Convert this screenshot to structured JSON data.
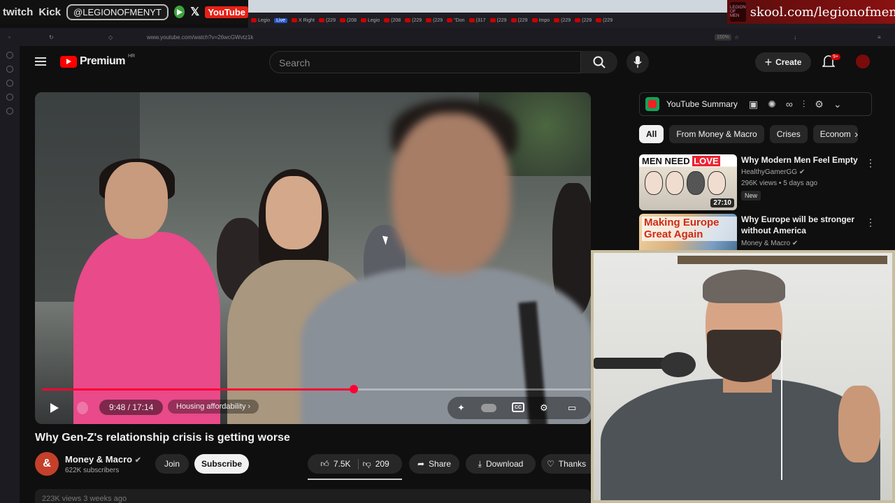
{
  "stream_overlay": {
    "brand1": "twitch",
    "brand2": "Kick",
    "handle": "@LEGIONOFMENYT",
    "youtube_label": "YouTube",
    "skool_url": "skool.com/legionofmen",
    "skool_logo_text": "LEGION OF MEN"
  },
  "browser": {
    "tabs": [
      {
        "label": "Legio",
        "live": false
      },
      {
        "label": "Live",
        "live": true
      },
      {
        "label": "X Right",
        "live": false
      },
      {
        "label": "(229",
        "live": false
      },
      {
        "label": "(208",
        "live": false
      },
      {
        "label": "Legio",
        "live": false
      },
      {
        "label": "(208",
        "live": false
      },
      {
        "label": "(229",
        "live": false
      },
      {
        "label": "(229",
        "live": false
      },
      {
        "label": "\"Don",
        "live": false
      },
      {
        "label": "(317",
        "live": false
      },
      {
        "label": "(229",
        "live": false
      },
      {
        "label": "(229",
        "live": false
      },
      {
        "label": "Impo",
        "live": false
      },
      {
        "label": "(229",
        "live": false
      },
      {
        "label": "(229",
        "live": false
      },
      {
        "label": "(229",
        "live": false
      }
    ],
    "url": "www.youtube.com/watch?v=26wcGWvtz1k",
    "zoom": "150%"
  },
  "header": {
    "logo_word": "Premium",
    "region": "HR",
    "search_placeholder": "Search",
    "create_label": "Create",
    "notifications_badge": "9+"
  },
  "player": {
    "time": "9:48 / 17:14",
    "chapter": "Housing affordability",
    "progress_fraction": 0.568,
    "cc_label": "CC"
  },
  "video": {
    "title": "Why Gen-Z's relationship crisis is getting worse",
    "channel": "Money & Macro",
    "channel_initial": "&",
    "subscribers": "622K subscribers",
    "join": "Join",
    "subscribe": "Subscribe",
    "likes": "7.5K",
    "dislikes": "209",
    "share": "Share",
    "download": "Download",
    "thanks": "Thanks",
    "views_line": "223K views  3 weeks ago"
  },
  "summary_bar": {
    "label": "YouTube Summary"
  },
  "chips": [
    "All",
    "From Money & Macro",
    "Crises",
    "Econom"
  ],
  "recommendations": [
    {
      "title": "Why Modern Men Feel Empty",
      "channel": "HealthyGamerGG",
      "meta": "296K views • 5 days ago",
      "badge": "New",
      "duration": "27:10",
      "thumb_text_a": "MEN NEED ",
      "thumb_text_b": "LOVE"
    },
    {
      "title": "Why Europe will be stronger without America",
      "channel": "Money & Macro",
      "thumb_text": "Making Europe Great Again"
    }
  ],
  "colors": {
    "accent": "#ff0033",
    "brand": "#ff0000",
    "page_bg": "#0f0f0f"
  }
}
